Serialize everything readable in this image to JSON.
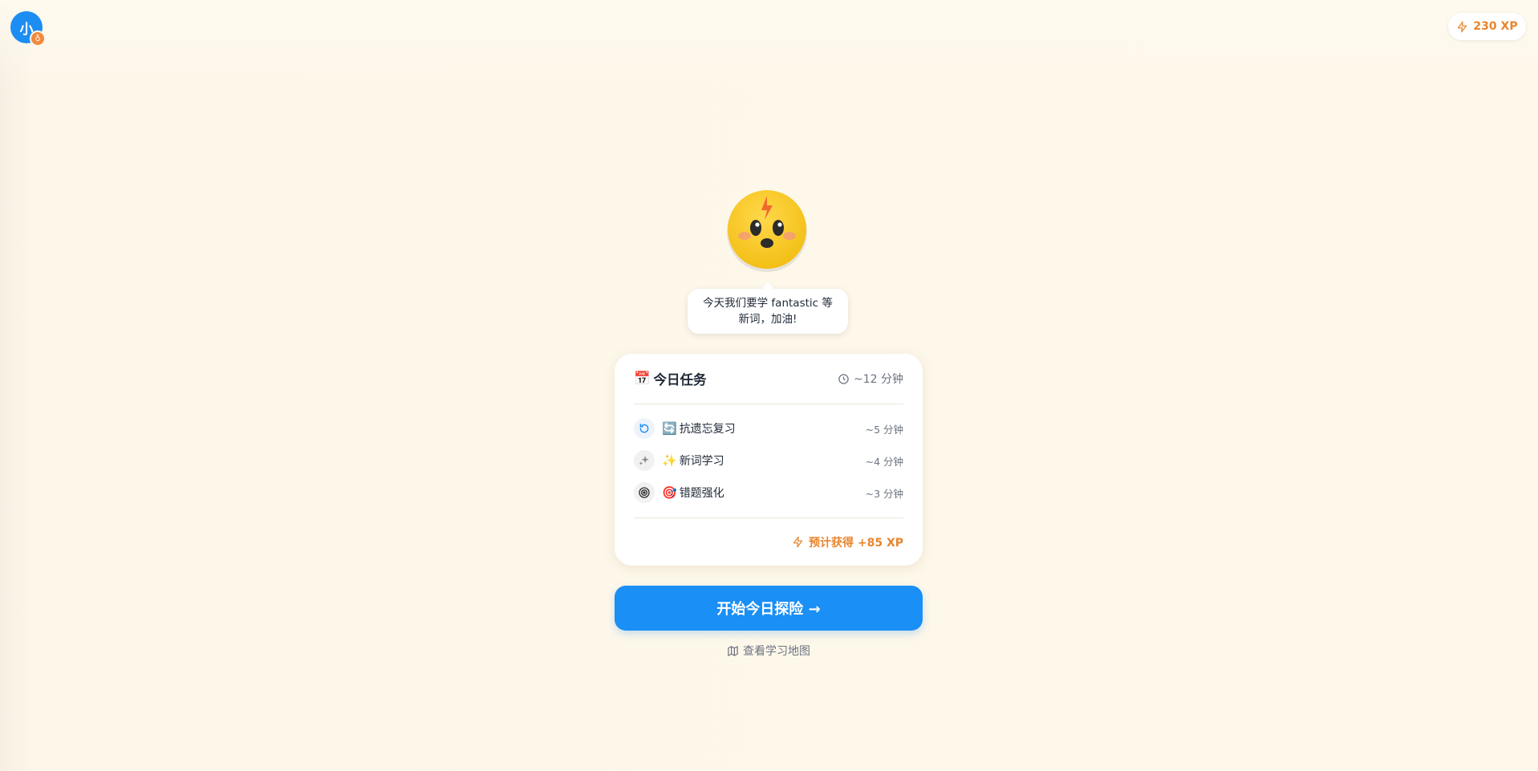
{
  "user": {
    "avatar_initial": "小",
    "badge_glyph": "♁"
  },
  "header": {
    "xp_label": "230 XP",
    "xp_icon": "lightning-icon"
  },
  "mascot": {
    "name": "lightning-mascot-icon",
    "message": "今天我们要学 fantastic 等新词，加油!"
  },
  "task_card": {
    "title_emoji": "📅",
    "title": "今日任务",
    "total_time": "~12 分钟",
    "tasks": [
      {
        "icon": "refresh-icon",
        "emoji": "🔄",
        "label": "抗遗忘复习",
        "time": "~5 分钟"
      },
      {
        "icon": "sparkles-icon",
        "emoji": "✨",
        "label": "新词学习",
        "time": "~4 分钟"
      },
      {
        "icon": "target-icon",
        "emoji": "🎯",
        "label": "错题强化",
        "time": "~3 分钟"
      }
    ],
    "reward": "预计获得 +85 XP"
  },
  "actions": {
    "start_label": "开始今日探险 →",
    "map_label": "查看学习地图"
  },
  "colors": {
    "primary": "#1a8ff5",
    "accent_orange": "#e8852e",
    "background": "#fef8ea"
  }
}
